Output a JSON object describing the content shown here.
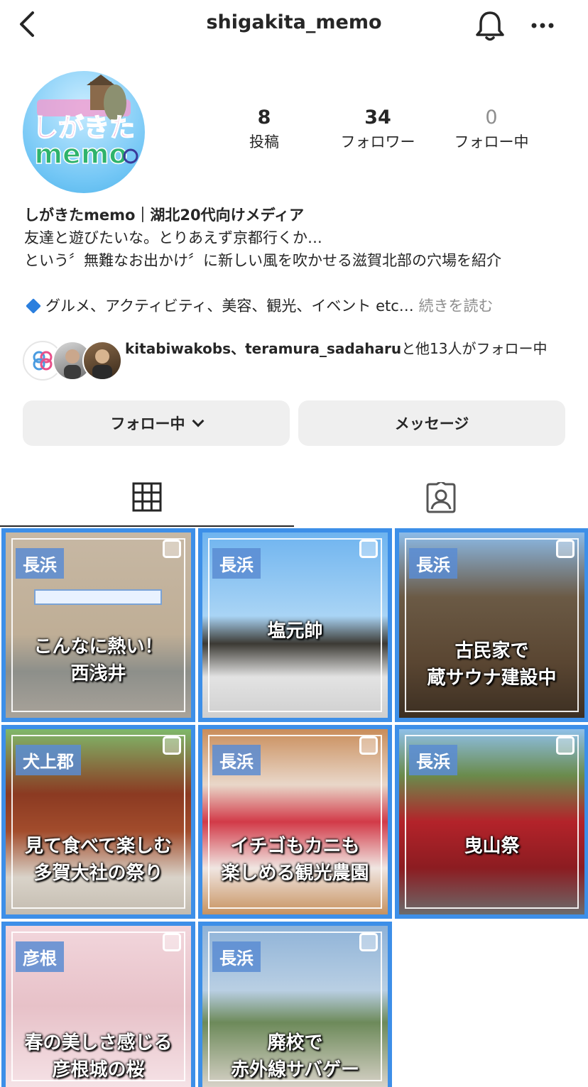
{
  "header": {
    "username": "shigakita_memo"
  },
  "profile": {
    "avatar_text_top": "しがきた",
    "avatar_text_bottom": "memo",
    "stats": [
      {
        "value": "8",
        "label": "投稿"
      },
      {
        "value": "34",
        "label": "フォロワー"
      },
      {
        "value": "0",
        "label": "フォロー中"
      }
    ]
  },
  "bio": {
    "name": "しがきたmemo｜湖北20代向けメディア",
    "line1": "友達と遊びたいな。とりあえず京都行くか‥.",
    "line2": "という〞無難なお出かけ〞に新しい風を吹かせる滋賀北部の穴場を紹介",
    "line3": "グルメ、アクティビティ、美容、観光、イベント etc…",
    "more": "続きを読む"
  },
  "mutuals": {
    "names": "kitabiwakobs、teramura_sadaharu",
    "suffix": "と他13人がフォロー中"
  },
  "actions": {
    "follow_label": "フォロー中",
    "message_label": "メッセージ"
  },
  "colors": {
    "tile_border": "#3d8fe8",
    "button_bg": "#efefef",
    "accent_blue": "#2b7fde"
  },
  "grid": {
    "tiles": [
      {
        "tag": "長浜",
        "caption1": "こんなに熱い！",
        "caption2": "西浅井"
      },
      {
        "tag": "長浜",
        "caption1": "塩元帥",
        "caption2": ""
      },
      {
        "tag": "長浜",
        "caption1": "古民家で",
        "caption2": "蔵サウナ建設中"
      },
      {
        "tag": "犬上郡",
        "caption1": "見て食べて楽しむ",
        "caption2": "多賀大社の祭り"
      },
      {
        "tag": "長浜",
        "caption1": "イチゴもカニも",
        "caption2": "楽しめる観光農園"
      },
      {
        "tag": "長浜",
        "caption1": "曳山祭",
        "caption2": ""
      },
      {
        "tag": "彦根",
        "caption1": "春の美しさ感じる",
        "caption2": "彦根城の桜"
      },
      {
        "tag": "長浜",
        "caption1": "廃校で",
        "caption2": "赤外線サバゲー"
      }
    ]
  }
}
